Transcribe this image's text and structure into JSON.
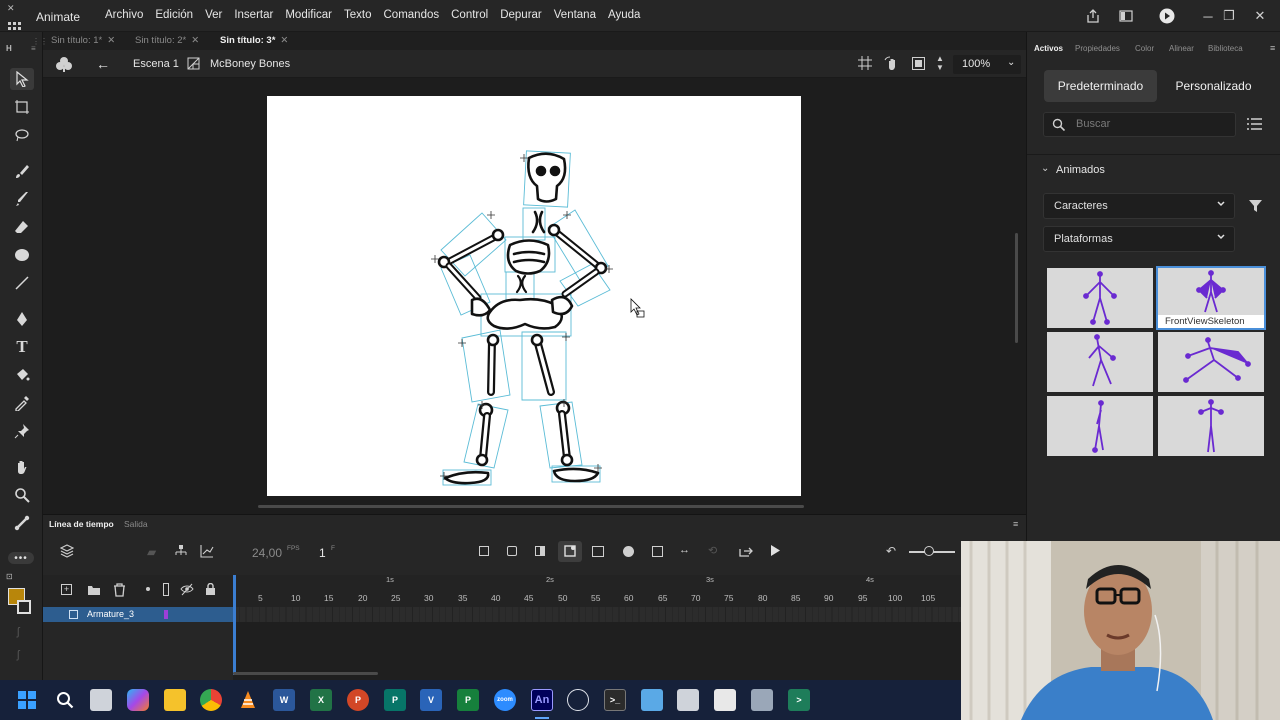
{
  "app": {
    "title": "Animate",
    "menus": [
      "Archivo",
      "Edición",
      "Ver",
      "Insertar",
      "Modificar",
      "Texto",
      "Comandos",
      "Control",
      "Depurar",
      "Ventana",
      "Ayuda"
    ]
  },
  "doc_tabs": [
    {
      "label": "Sin título: 1*",
      "active": false
    },
    {
      "label": "Sin título: 2*",
      "active": false
    },
    {
      "label": "Sin título: 3*",
      "active": true
    }
  ],
  "editbar": {
    "scene": "Escena 1",
    "symbol": "McBoney Bones",
    "zoom": "100%"
  },
  "timeline": {
    "tabs": [
      "Línea de tiempo",
      "Salida"
    ],
    "fps": "24,00",
    "fps_unit": "FPS",
    "frame": "1",
    "frame_unit": "F",
    "layer_name": "Armature_3",
    "frame_numbers": [
      "5",
      "10",
      "15",
      "20",
      "25",
      "30",
      "35",
      "40",
      "45",
      "50",
      "55",
      "60",
      "65",
      "70",
      "75",
      "80",
      "85",
      "90",
      "95",
      "100",
      "105"
    ],
    "second_markers": [
      "1s",
      "2s",
      "3s",
      "4s"
    ]
  },
  "right_panel": {
    "tabs": [
      "Activos",
      "Propiedades",
      "Color",
      "Alinear",
      "Biblioteca"
    ],
    "btn_default": "Predeterminado",
    "btn_custom": "Personalizado",
    "search_placeholder": "Buscar",
    "section": "Animados",
    "dropdown1": "Caracteres",
    "dropdown2": "Plataformas",
    "selected_thumb_label": "FrontViewSkeleton"
  },
  "colors": {
    "accent": "#4a8fd9",
    "layer_selected": "#2d5d8f",
    "fill_swatch": "#b8860b",
    "skeleton_thumb": "#6a2ad1"
  }
}
